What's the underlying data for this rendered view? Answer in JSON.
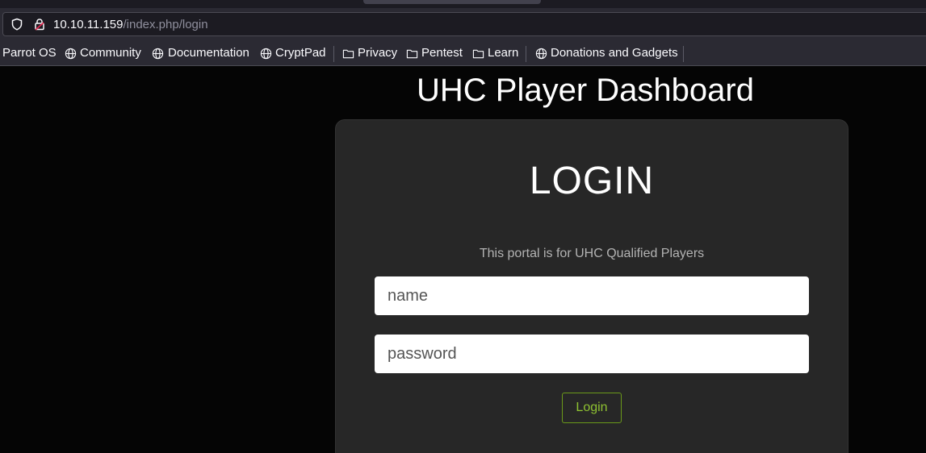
{
  "browser": {
    "url_host": "10.10.11.159",
    "url_path": "/index.php/login",
    "icons": {
      "tracking": "shield-icon",
      "security": "lock-warning-icon"
    },
    "colors": {
      "lock_warning": "#e22850"
    }
  },
  "bookmarks": {
    "items": [
      {
        "label": "Parrot OS",
        "icon": "none"
      },
      {
        "label": "Community",
        "icon": "globe-icon"
      },
      {
        "label": "Documentation",
        "icon": "globe-icon"
      },
      {
        "label": "CryptPad",
        "icon": "globe-icon"
      },
      {
        "label": "Privacy",
        "icon": "folder-icon"
      },
      {
        "label": "Pentest",
        "icon": "folder-icon"
      },
      {
        "label": "Learn",
        "icon": "folder-icon"
      },
      {
        "label": "Donations and Gadgets",
        "icon": "globe-icon"
      }
    ]
  },
  "page": {
    "title": "UHC Player Dashboard",
    "login": {
      "heading": "LOGIN",
      "subtitle": "This portal is for UHC Qualified Players",
      "name_placeholder": "name",
      "password_placeholder": "password",
      "submit_label": "Login"
    },
    "colors": {
      "background": "#050505",
      "card": "#272727",
      "accent": "#8fc231"
    }
  }
}
